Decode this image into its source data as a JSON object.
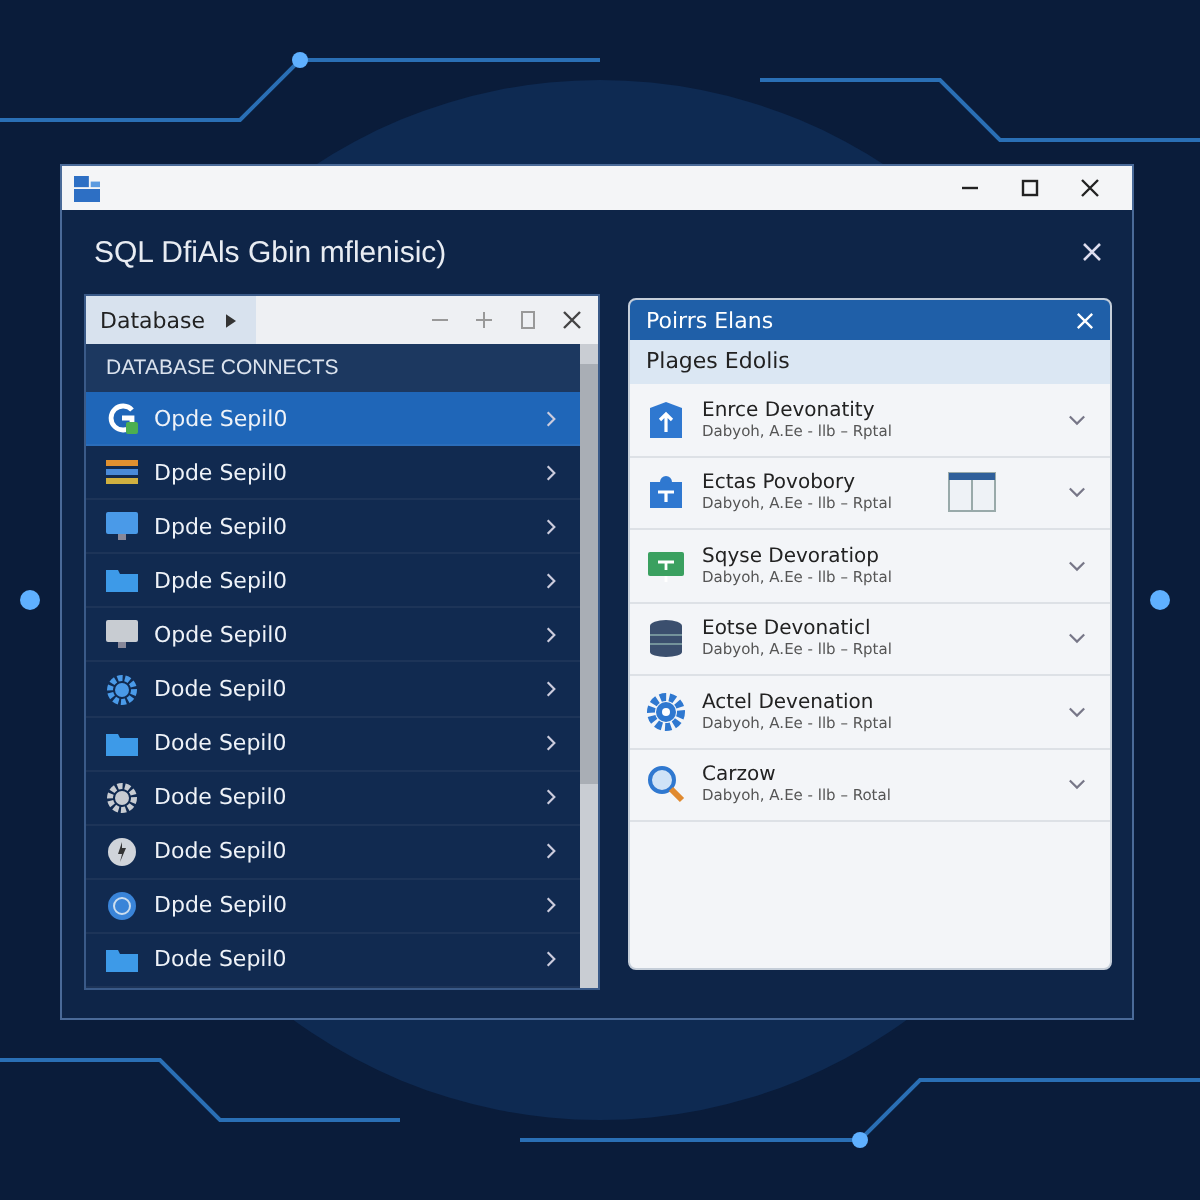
{
  "window": {
    "title": "SQL DfiAls Gbin mflenisic)"
  },
  "left_panel": {
    "tab": "Database",
    "section": "DATABASE CONNECTS",
    "items": [
      {
        "label": "Opde Sepil0",
        "kind": "badge",
        "selected": true
      },
      {
        "label": "Dpde Sepil0",
        "kind": "grid",
        "selected": false
      },
      {
        "label": "Dpde Sepil0",
        "kind": "monitor",
        "selected": false
      },
      {
        "label": "Dpde Sepil0",
        "kind": "folder",
        "selected": false
      },
      {
        "label": "Opde Sepil0",
        "kind": "terminal",
        "selected": false
      },
      {
        "label": "Dode Sepil0",
        "kind": "gear",
        "selected": false
      },
      {
        "label": "Dode Sepil0",
        "kind": "folder",
        "selected": false
      },
      {
        "label": "Dode Sepil0",
        "kind": "cog",
        "selected": false
      },
      {
        "label": "Dode Sepil0",
        "kind": "bolt",
        "selected": false
      },
      {
        "label": "Dpde Sepil0",
        "kind": "globe",
        "selected": false
      },
      {
        "label": "Dode Sepil0",
        "kind": "folder",
        "selected": false
      }
    ]
  },
  "right_panel": {
    "title": "Poirrs Elans",
    "subtitle": "Plages Edolis",
    "items": [
      {
        "title": "Enrce Devonatity",
        "detail": "Dabyoh, A.Ee - llb – Rptal",
        "kind": "building",
        "window_icon": false
      },
      {
        "title": "Ectas Povobory",
        "detail": "Dabyoh, A.Ee - llb – Rptal",
        "kind": "puzzle",
        "window_icon": true
      },
      {
        "title": "Sqyse Devoratiop",
        "detail": "Dabyoh, A.Ee - llb – Rptal",
        "kind": "screen",
        "window_icon": false
      },
      {
        "title": "Eotse Devonaticl",
        "detail": "Dabyoh, A.Ee - llb – Rptal",
        "kind": "database",
        "window_icon": false
      },
      {
        "title": "Actel Devenation",
        "detail": "Dabyoh, A.Ee - llb – Rptal",
        "kind": "gear",
        "window_icon": false
      },
      {
        "title": "Carzow",
        "detail": "Dabyoh, A.Ee - llb – Rotal",
        "kind": "search",
        "window_icon": false
      }
    ]
  }
}
